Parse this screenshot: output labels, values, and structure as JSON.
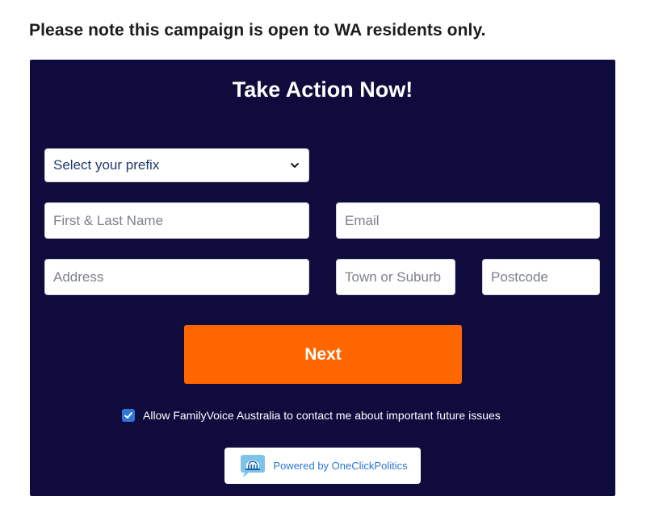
{
  "notice": "Please note this campaign is open to WA residents only.",
  "form": {
    "title": "Take Action Now!",
    "prefix_select": {
      "selected": "Select your prefix"
    },
    "placeholders": {
      "name": "First & Last Name",
      "email": "Email",
      "address": "Address",
      "town": "Town or Suburb",
      "postcode": "Postcode"
    },
    "next_label": "Next",
    "consent": {
      "checked": true,
      "label": "Allow FamilyVoice Australia to contact me about important future issues"
    },
    "powered_by": "Powered by OneClickPolitics"
  },
  "colors": {
    "panel_bg": "#0f0b3d",
    "accent_orange": "#ff6600",
    "link_blue": "#2f76d6"
  },
  "icons": {
    "select": "chevron-down-icon",
    "checkbox": "checkmark-icon",
    "logo": "oneclickpolitics-capitol-icon"
  }
}
